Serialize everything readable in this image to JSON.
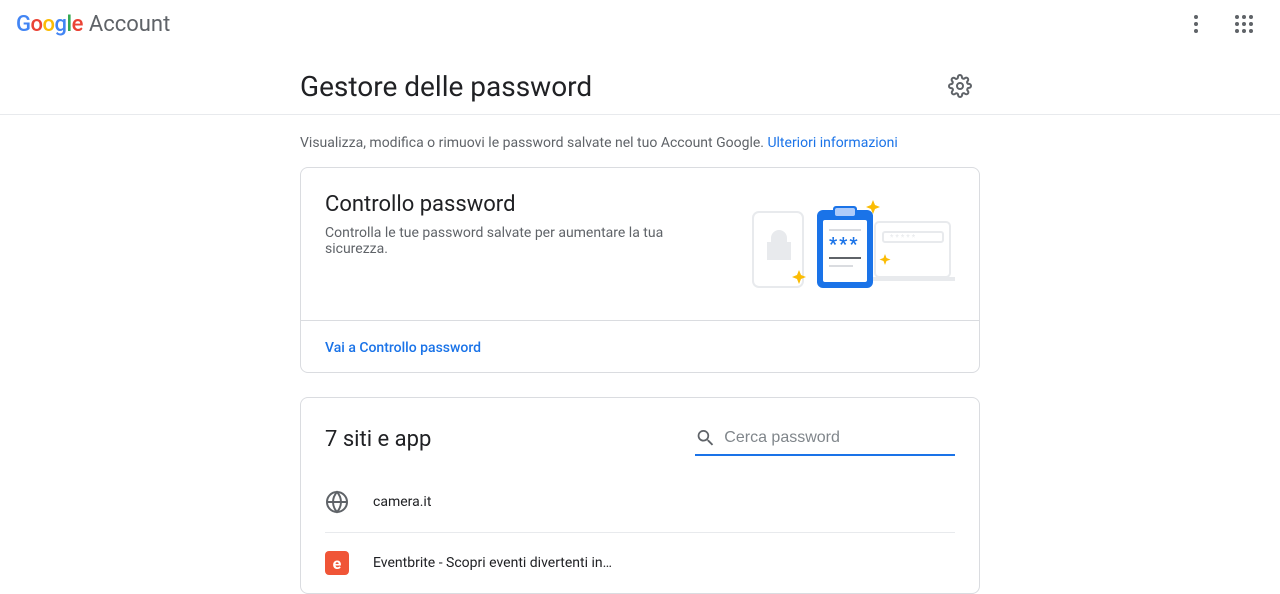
{
  "header": {
    "brand": "Google",
    "product": "Account"
  },
  "page": {
    "title": "Gestore delle password",
    "description": "Visualizza, modifica o rimuovi le password salvate nel tuo Account Google. ",
    "learn_more": "Ulteriori informazioni"
  },
  "checkup": {
    "title": "Controllo password",
    "subtitle": "Controlla le tue password salvate per aumentare la tua sicurezza.",
    "cta": "Vai a Controllo password"
  },
  "sites": {
    "title": "7 siti e app",
    "search_placeholder": "Cerca password",
    "items": [
      {
        "name": "camera.it",
        "icon": "globe"
      },
      {
        "name": "Eventbrite - Scopri eventi divertenti in…",
        "icon": "eventbrite"
      }
    ]
  }
}
